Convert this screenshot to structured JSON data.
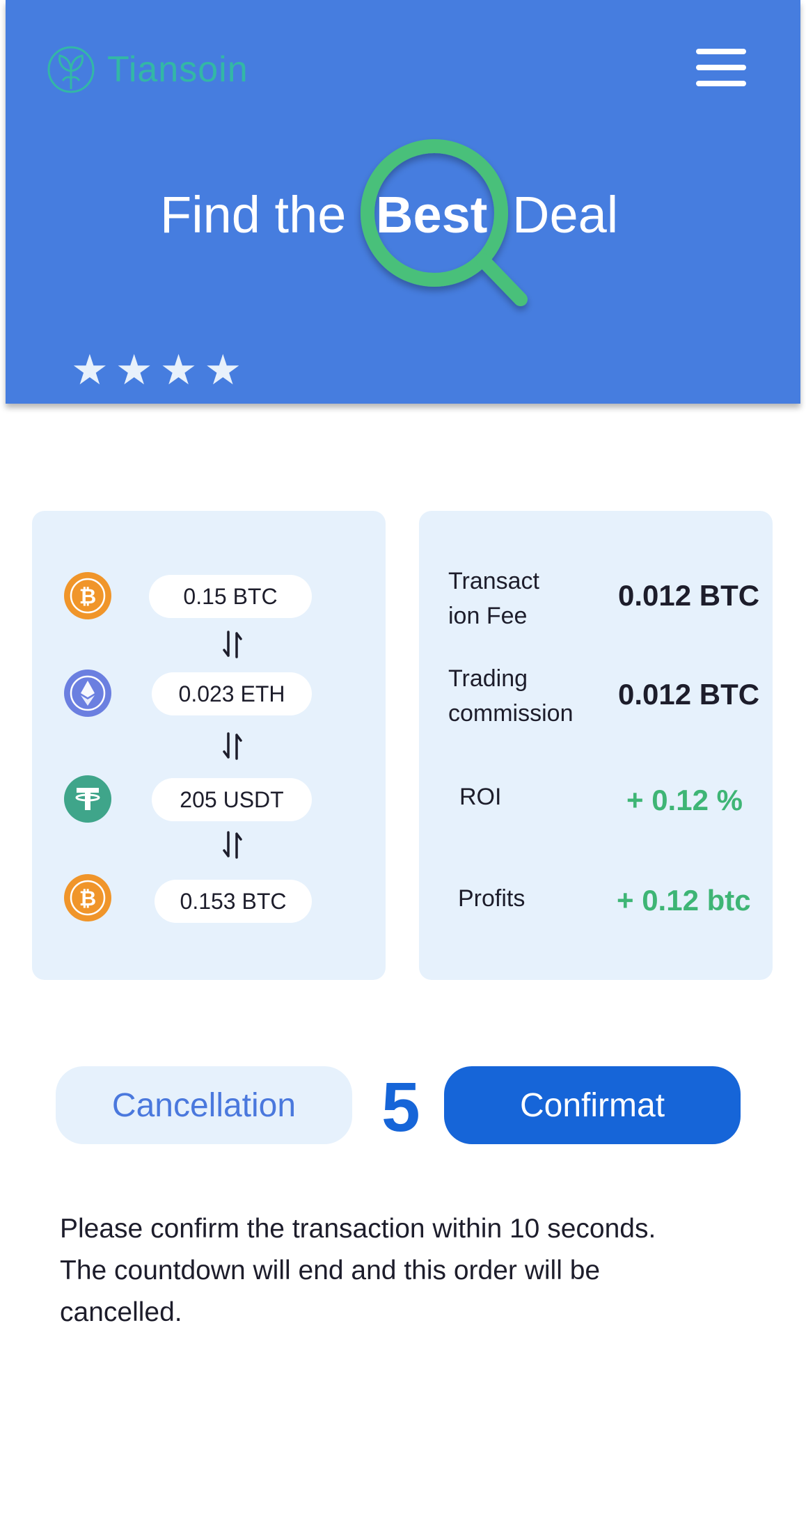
{
  "header": {
    "brand": "Tiansoin",
    "headline": {
      "part1": "Find the",
      "highlight": "Best",
      "part2": "Deal"
    },
    "stars": [
      "★",
      "★",
      "★",
      "★"
    ],
    "colors": {
      "background": "#467ddf",
      "brand": "#33b7a6",
      "magnifier": "#48c07a"
    }
  },
  "route": {
    "steps": [
      {
        "icon": "bitcoin-icon",
        "amount": "0.15 BTC"
      },
      {
        "icon": "ethereum-icon",
        "amount": "0.023 ETH"
      },
      {
        "icon": "tether-icon",
        "amount": "205 USDT"
      },
      {
        "icon": "bitcoin-icon",
        "amount": "0.153 BTC"
      }
    ],
    "swap_icon": "swap-arrows-icon"
  },
  "fees": {
    "transaction_fee": {
      "label_line1": "Transact",
      "label_line2": "ion Fee",
      "value": "0.012 BTC"
    },
    "trading_commission": {
      "label_line1": "Trading",
      "label_line2": "commission",
      "value": "0.012 BTC"
    },
    "roi": {
      "label": "ROI",
      "value": "+ 0.12 %"
    },
    "profits": {
      "label": "Profits",
      "value": "+ 0.12 btc"
    },
    "colors": {
      "positive": "#3eb575",
      "value": "#1d1d2b"
    }
  },
  "actions": {
    "cancel_label": "Cancellation",
    "countdown": "5",
    "confirm_label": "Confirmat"
  },
  "notice": {
    "line1": "Please confirm the transaction within 10 seconds.",
    "line2": "The countdown will end and this order will be",
    "line3": "cancelled."
  }
}
